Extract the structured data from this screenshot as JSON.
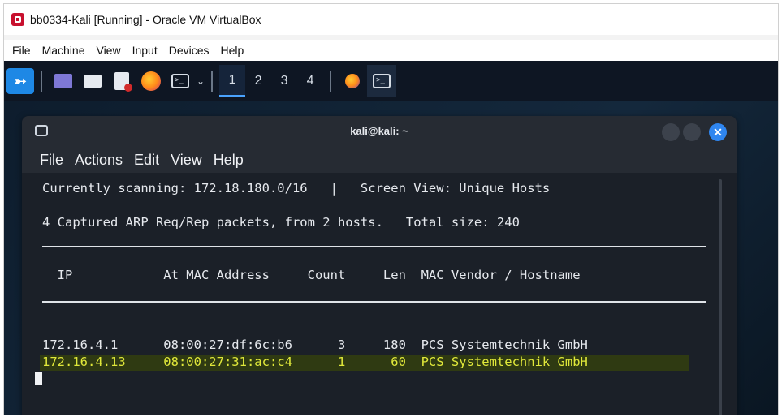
{
  "window": {
    "title": "bb0334-Kali [Running] - Oracle VM VirtualBox",
    "menu": [
      "File",
      "Machine",
      "View",
      "Input",
      "Devices",
      "Help"
    ]
  },
  "taskbar": {
    "workspaces": [
      "1",
      "2",
      "3",
      "4"
    ],
    "active_workspace": "1",
    "icons": [
      "kali-menu-icon",
      "desktop-icon",
      "file-manager-icon",
      "text-editor-icon",
      "firefox-icon",
      "terminal-icon"
    ]
  },
  "terminal": {
    "title": "kali@kali: ~",
    "menu": [
      "File",
      "Actions",
      "Edit",
      "View",
      "Help"
    ],
    "header_line1": "Currently scanning: 172.18.180.0/16   |   Screen View: Unique Hosts",
    "header_line2": "4 Captured ARP Req/Rep packets, from 2 hosts.   Total size: 240",
    "columns_line": "  IP            At MAC Address     Count     Len  MAC Vendor / Hostname",
    "rows": [
      {
        "line": "172.16.4.1      08:00:27:df:6c:b6      3     180  PCS Systemtechnik GmbH",
        "highlighted": false
      },
      {
        "line": "172.16.4.13     08:00:27:31:ac:c4      1      60  PCS Systemtechnik GmbH",
        "highlighted": true
      }
    ],
    "highlight_color": "#e0e83a"
  }
}
